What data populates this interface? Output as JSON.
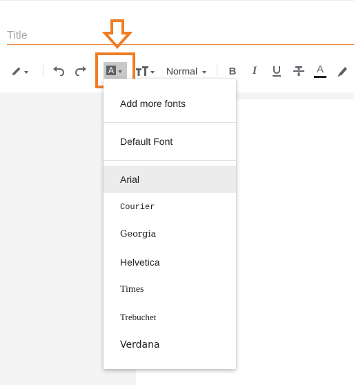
{
  "title": {
    "placeholder": "Title"
  },
  "toolbar": {
    "style_select_label": "Normal",
    "icons": [
      "pen-icon",
      "undo-icon",
      "redo-icon",
      "text-size-icon",
      "bold-icon",
      "italic-icon",
      "underline-icon",
      "strikethrough-icon",
      "text-color-icon",
      "highlight-icon"
    ],
    "font_button_glyph": "A",
    "bold_glyph": "B",
    "italic_glyph": "I",
    "text_color_glyph": "A"
  },
  "font_menu": {
    "add_more_label": "Add more fonts",
    "default_label": "Default Font",
    "fonts": [
      "Arial",
      "Courier",
      "Georgia",
      "Helvetica",
      "Times",
      "Trebuchet",
      "Verdana"
    ],
    "selected": "Arial"
  },
  "annotation": {
    "color": "#f07c23"
  },
  "colors": {
    "accent": "#e8823b",
    "menu_hover": "#ececec",
    "icon": "#5f6368"
  }
}
